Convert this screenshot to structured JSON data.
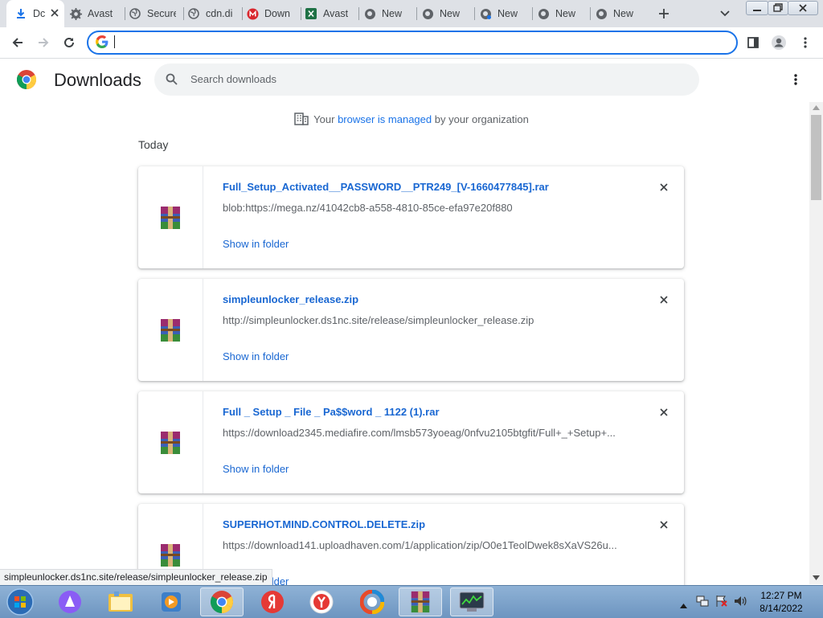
{
  "tabs": [
    {
      "label": "Dc",
      "icon": "download-icon"
    },
    {
      "label": "Avast",
      "icon": "gear-icon"
    },
    {
      "label": "Secure",
      "icon": "globe-icon"
    },
    {
      "label": "cdn.di",
      "icon": "globe-icon"
    },
    {
      "label": "Down",
      "icon": "mega-icon"
    },
    {
      "label": "Avast",
      "icon": "excel-icon"
    },
    {
      "label": "New T",
      "icon": "chrome-icon"
    },
    {
      "label": "New T",
      "icon": "chrome-icon"
    },
    {
      "label": "New T",
      "icon": "chrome-icon"
    },
    {
      "label": "New T",
      "icon": "chrome-icon"
    },
    {
      "label": "New T",
      "icon": "chrome-icon"
    }
  ],
  "toolbar": {
    "omnibox_value": ""
  },
  "page": {
    "title": "Downloads",
    "search_placeholder": "Search downloads",
    "managed_prefix": "Your",
    "managed_link": "browser is managed",
    "managed_suffix": "by your organization",
    "section_label": "Today"
  },
  "downloads": [
    {
      "filename": "Full_Setup_Activated__PASSWORD__PTR249_[V-1660477845].rar",
      "url": "blob:https://mega.nz/41042cb8-a558-4810-85ce-efa97e20f880",
      "action": "Show in folder"
    },
    {
      "filename": "simpleunlocker_release.zip",
      "url": "http://simpleunlocker.ds1nc.site/release/simpleunlocker_release.zip",
      "action": "Show in folder"
    },
    {
      "filename": "Full _ Setup _ File _ Pa$$word _ 1122 (1).rar",
      "url": "https://download2345.mediafire.com/lmsb573yoeag/0nfvu2105btgfit/Full+_+Setup+...",
      "action": "Show in folder"
    },
    {
      "filename": "SUPERHOT.MIND.CONTROL.DELETE.zip",
      "url": "https://download141.uploadhaven.com/1/application/zip/O0e1TeolDwek8sXaVS26u...",
      "action": "Show in folder"
    }
  ],
  "status_bar": "simpleunlocker.ds1nc.site/release/simpleunlocker_release.zip",
  "taskbar": {
    "apps": [
      "start-orb-icon",
      "alice-icon",
      "explorer-icon",
      "media-player-icon",
      "chrome-icon",
      "yandex-icon",
      "yandex-browser-icon",
      "avast-secure-browser-icon",
      "winrar-icon",
      "task-manager-icon"
    ],
    "time": "12:27 PM",
    "date": "8/14/2022"
  },
  "colors": {
    "accent": "#1a73e8",
    "link": "#1967d2",
    "tabstrip": "#dee1e6"
  }
}
